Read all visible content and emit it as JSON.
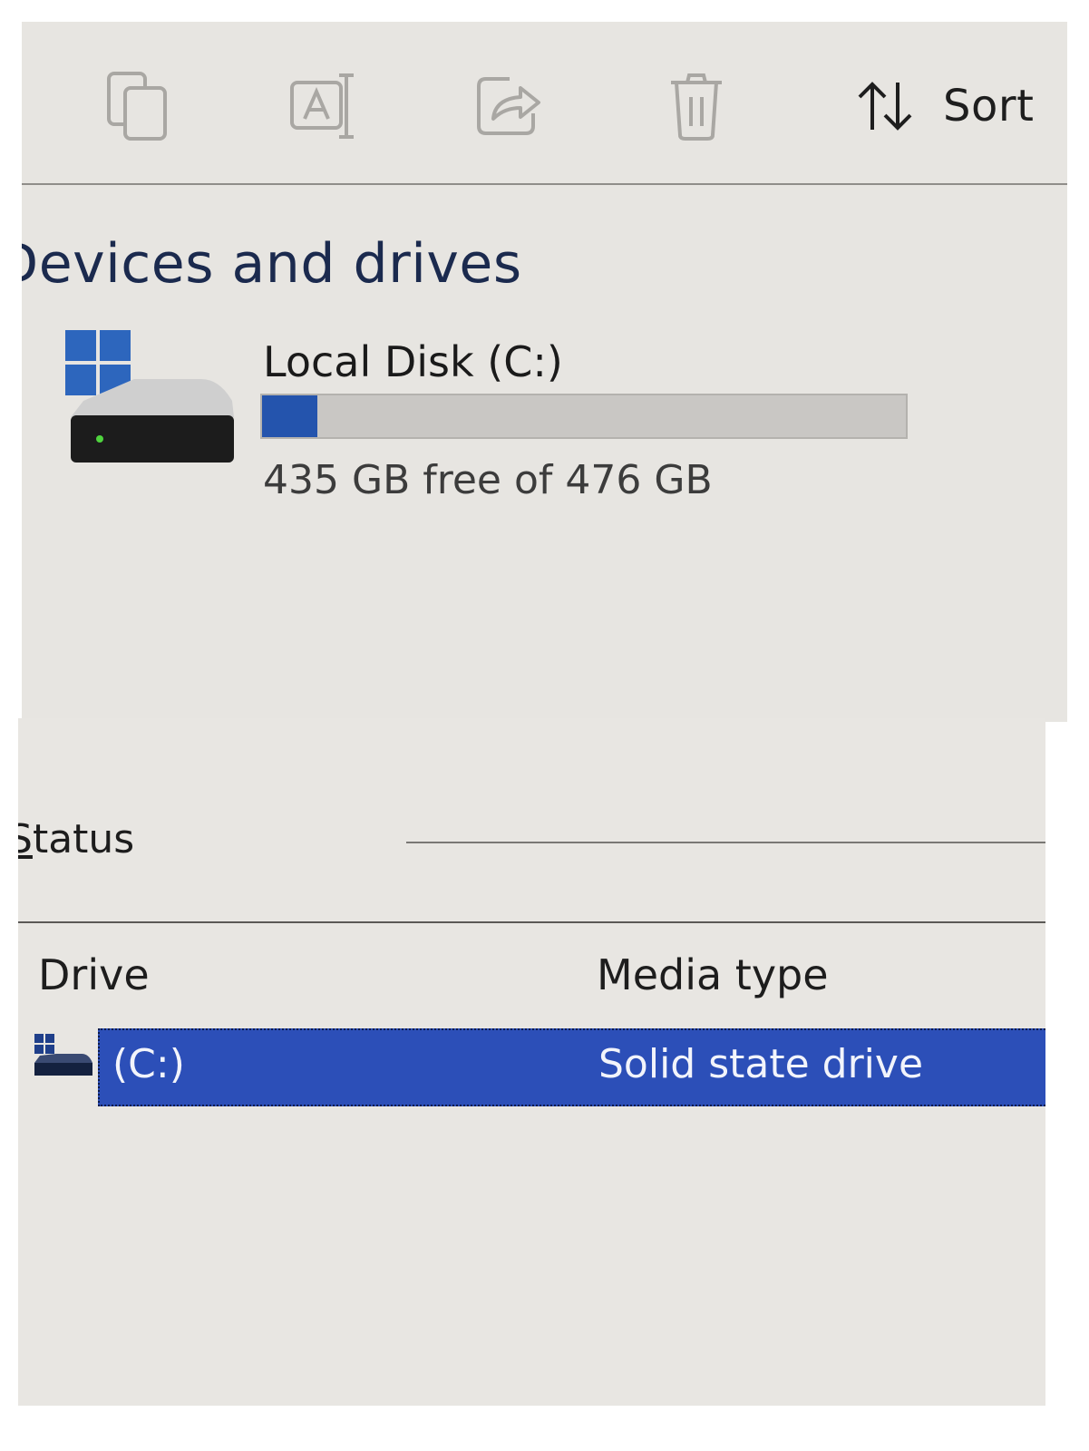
{
  "explorer": {
    "toolbar": {
      "buttons": [
        {
          "icon": "copy-icon"
        },
        {
          "icon": "rename-icon"
        },
        {
          "icon": "share-icon"
        },
        {
          "icon": "delete-icon"
        }
      ],
      "sort_icon": "sort-arrows-icon",
      "sort_label": "Sort"
    },
    "section_heading": "Devices and drives",
    "drive": {
      "icon": "windows-drive-icon",
      "name": "Local Disk (C:)",
      "free_text": "435 GB free of 476 GB",
      "used_fraction": 0.086,
      "bar_color": "#2454ad"
    }
  },
  "optimize": {
    "status_label": "Status",
    "columns": [
      "Drive",
      "Media type"
    ],
    "rows": [
      {
        "icon": "drive-icon",
        "drive": "(C:)",
        "media_type": "Solid state drive",
        "selected": true
      }
    ],
    "selection_color": "#2c4fb8"
  }
}
